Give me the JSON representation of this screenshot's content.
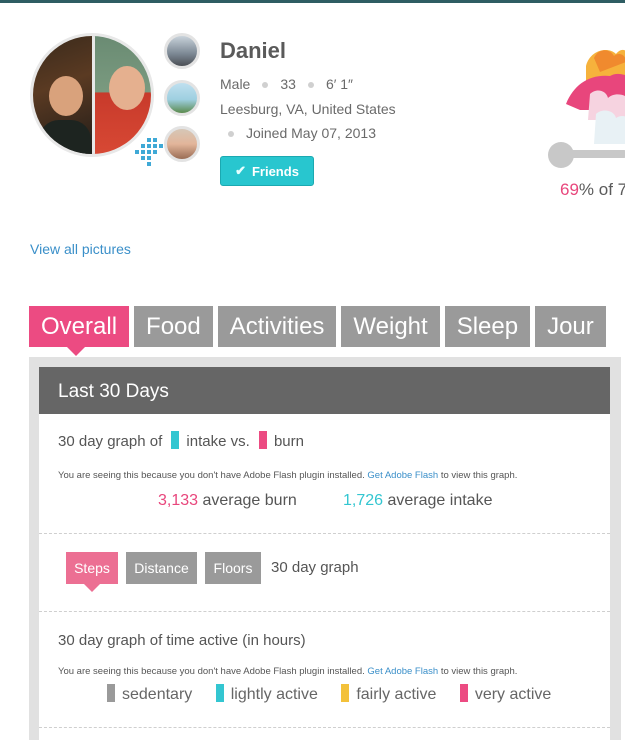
{
  "colors": {
    "accent": "#ec4b82",
    "teal": "#28c6cf",
    "link": "#3a8fc9",
    "gray_tab": "#9a9a9a",
    "panel_header": "#666666"
  },
  "profile": {
    "name": "Daniel",
    "gender": "Male",
    "age": "33",
    "height": "6′ 1″",
    "location": "Leesburg, VA, United States",
    "joined": "Joined May 07, 2013",
    "friends_label": "Friends",
    "view_all_pictures": "View all pictures"
  },
  "goal": {
    "percent": "69",
    "suffix": "% of 7"
  },
  "tabs": [
    {
      "label": "Overall",
      "active": true
    },
    {
      "label": "Food"
    },
    {
      "label": "Activities"
    },
    {
      "label": "Weight"
    },
    {
      "label": "Sleep"
    },
    {
      "label": "Jour"
    }
  ],
  "panel": {
    "title": "Last 30 Days",
    "intake_burn": {
      "prefix": "30 day graph of",
      "intake_label": "intake vs.",
      "burn_label": "burn",
      "flash_before": "You are seeing this because you don't have Adobe Flash plugin installed.",
      "flash_link": "Get Adobe Flash",
      "flash_after": "to view this graph.",
      "avg_burn_value": "3,133",
      "avg_burn_label": "average burn",
      "avg_intake_value": "1,726",
      "avg_intake_label": "average intake"
    },
    "steps": {
      "buttons": [
        "Steps",
        "Distance",
        "Floors"
      ],
      "label": "30 day graph"
    },
    "time_active": {
      "title": "30 day graph of time active (in hours)",
      "flash_before": "You are seeing this because you don't have Adobe Flash plugin installed.",
      "flash_link": "Get Adobe Flash",
      "flash_after": "to view this graph.",
      "legend": [
        "sedentary",
        "lightly active",
        "fairly active",
        "very active"
      ]
    }
  }
}
